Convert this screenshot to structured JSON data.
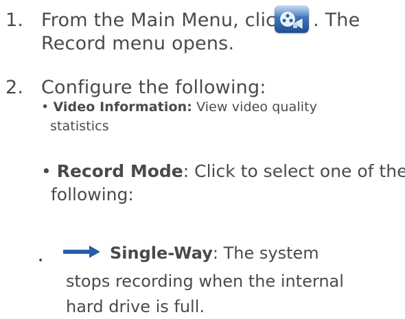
{
  "steps": [
    {
      "number": "1.",
      "text_before_icon": "From the Main Menu, click",
      "text_after_icon": ". The",
      "continuation": "Record menu opens.",
      "icon": "record-menu-icon"
    },
    {
      "number": "2.",
      "text": "Configure the following:"
    }
  ],
  "options": [
    {
      "bullet": "•",
      "label": "Video Information:",
      "desc_line1": "View video quality",
      "desc_line2": "statistics"
    },
    {
      "bullet": "•",
      "label": "Record Mode",
      "desc_line1": ": Click to select one of the",
      "desc_line2": "following:"
    }
  ],
  "sub_options": [
    {
      "bullet": "•",
      "icon": "right-arrow-icon",
      "label": "Single-Way",
      "desc_line1": ": The system",
      "desc_line2": "stops recording when the internal",
      "desc_line3": "hard drive is full."
    }
  ],
  "colors": {
    "text": "#4a4a4a",
    "icon_blue": "#3f74b8",
    "arrow_blue": "#2a5da8"
  }
}
